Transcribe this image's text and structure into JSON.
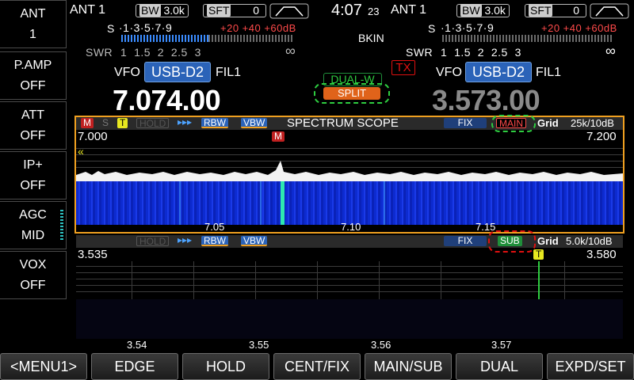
{
  "left_panel": [
    {
      "label": "ANT",
      "value": "1"
    },
    {
      "label": "P.AMP",
      "value": "OFF"
    },
    {
      "label": "ATT",
      "value": "OFF"
    },
    {
      "label": "IP+",
      "value": "OFF"
    },
    {
      "label": "AGC",
      "value": "MID"
    },
    {
      "label": "VOX",
      "value": "OFF"
    }
  ],
  "main": {
    "ant": "ANT 1",
    "bw_label": "BW",
    "bw_value": "3.0k",
    "sft_label": "SFT",
    "sft_value": "0",
    "s_label": "S",
    "s_scale": "·1·3·5·7·9",
    "s_plus": "+20 +40 +60dB",
    "swr_label": "SWR",
    "swr_scale": "1  1.5  2  2.5  3",
    "swr_inf": "∞",
    "vfo_label": "VFO",
    "mode": "USB-D2",
    "filter": "FIL1",
    "frequency": "7.074.00"
  },
  "sub": {
    "ant": "ANT 1",
    "bw_label": "BW",
    "bw_value": "3.0k",
    "sft_label": "SFT",
    "sft_value": "0",
    "s_label": "S",
    "s_scale": "·1·3·5·7·9",
    "s_plus": "+20 +40 +60dB",
    "swr_label": "SWR",
    "swr_scale": "1  1.5  2  2.5  3",
    "swr_inf": "∞",
    "vfo_label": "VFO",
    "mode": "USB-D2",
    "filter": "FIL1",
    "frequency": "3.573.00"
  },
  "center": {
    "time": "4:07",
    "seconds": "23",
    "bkin": "BKIN",
    "tx": "TX",
    "dual_w": "DUAL-W",
    "split": "SPLIT"
  },
  "scope_main": {
    "tag_m": "M",
    "tag_s": "S",
    "tag_t": "T",
    "hold": "HOLD",
    "arrows": "▸▸▸",
    "rbw": "RBW",
    "vbw": "VBW",
    "title": "SPECTRUM SCOPE",
    "fix": "FIX",
    "main_tag": "MAIN",
    "grid": "Grid",
    "span": "25k/10dB",
    "start": "7.000",
    "end": "7.200",
    "marker": "M",
    "left_arrow": "«",
    "ticks": [
      "7.05",
      "7.10",
      "7.15"
    ]
  },
  "scope_sub": {
    "hold": "HOLD",
    "arrows": "▸▸▸",
    "rbw": "RBW",
    "vbw": "VBW",
    "fix": "FIX",
    "sub_tag": "SUB",
    "grid": "Grid",
    "span": "5.0k/10dB",
    "start": "3.535",
    "end": "3.580",
    "marker": "T",
    "ticks": [
      "3.54",
      "3.55",
      "3.56",
      "3.57"
    ]
  },
  "bottom_menu": [
    "<MENU1>",
    "EDGE",
    "HOLD",
    "CENT/FIX",
    "MAIN/SUB",
    "DUAL",
    "EXPD/SET"
  ],
  "colors": {
    "accent_blue": "#2b63b8",
    "scope_border": "#f0a020",
    "tx_red": "#e01010",
    "split_orange": "#e0631a",
    "dual_green": "#1f8f3a"
  }
}
